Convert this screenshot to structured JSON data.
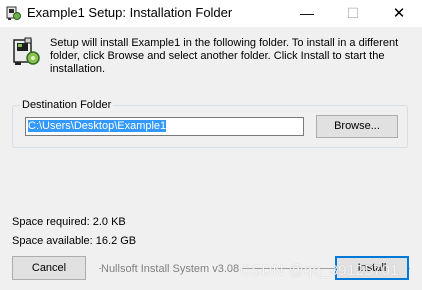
{
  "window": {
    "title": "Example1 Setup: Installation Folder",
    "minimize_glyph": "—",
    "maximize_glyph": "☐",
    "close_glyph": "✕"
  },
  "header": {
    "icon": "installer-box-icon",
    "intro": "Setup will install Example1 in the following folder. To install in a different\nfolder, click Browse and select another folder. Click Install to start the\ninstallation."
  },
  "destination": {
    "group_label": "Destination Folder",
    "path": "C:\\Users\\Desktop\\Example1",
    "browse_label": "Browse..."
  },
  "space": {
    "required": "Space required: 2.0 KB",
    "available": "Space available: 16.2 GB"
  },
  "footer": {
    "brand": "Nullsoft Install System v3.08",
    "cancel_label": "Cancel",
    "install_label": "Install",
    "watermark": "CSDN @qq_39125701"
  },
  "colors": {
    "selection": "#3399ff",
    "focus_border": "#0078d7",
    "dialog_bg": "#f0f0f0"
  }
}
